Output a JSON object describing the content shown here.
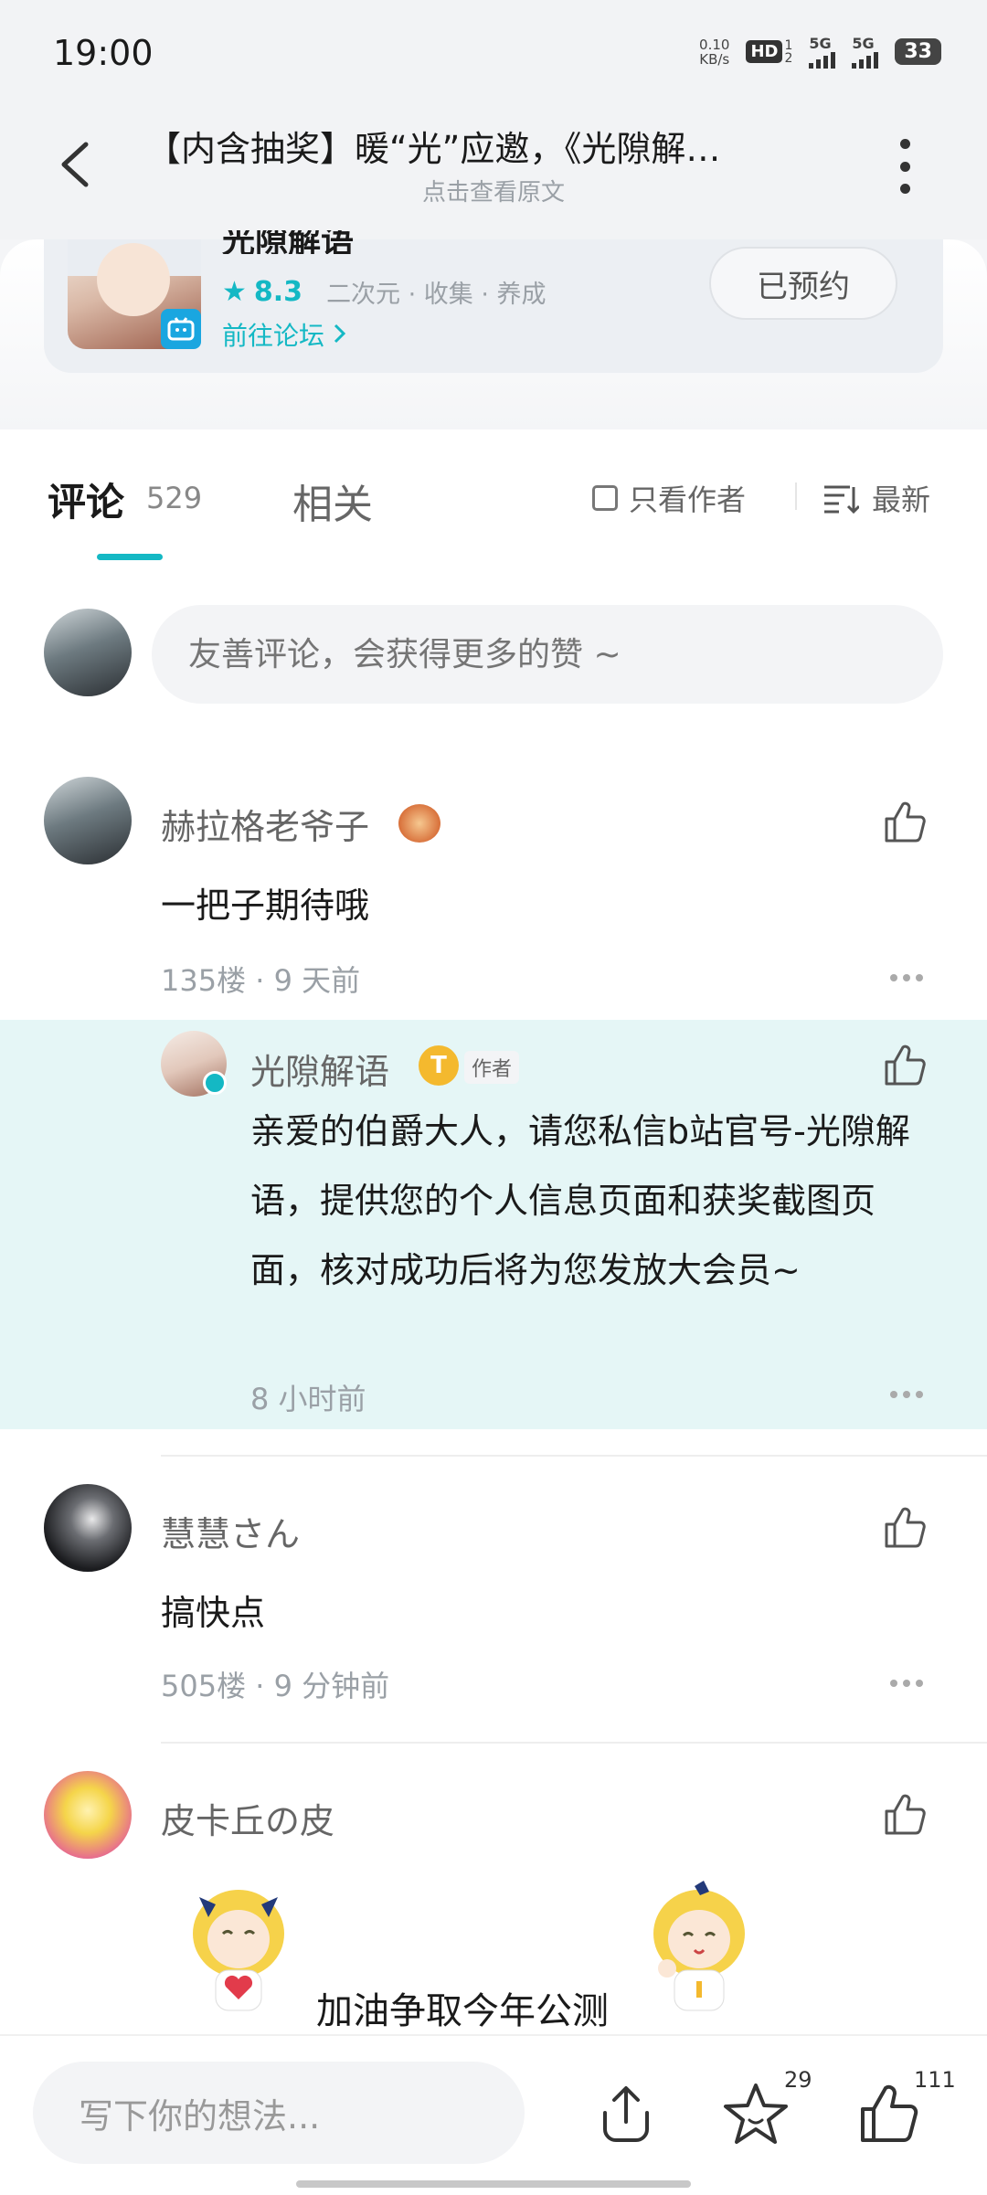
{
  "status_bar": {
    "time": "19:00",
    "net_speed_value": "0.10",
    "net_speed_unit": "KB/s",
    "hd": "HD",
    "sim1": "1",
    "sim2": "2",
    "signal_label_1": "5G",
    "signal_label_2": "5G",
    "battery": "33"
  },
  "header": {
    "title": "【内含抽奖】暖“光”应邀，《光隙解…",
    "subtitle": "点击查看原文"
  },
  "game_card": {
    "name": "光隙解语",
    "rating": "8.3",
    "tags": "二次元  ·  收集  ·  养成",
    "forum_link": "前往论坛 ",
    "reserve_label": "已预约"
  },
  "tabs": {
    "comments_label": "评论",
    "comments_count": "529",
    "related_label": "相关",
    "only_author_label": "只看作者",
    "sort_label": "最新"
  },
  "comment_input": {
    "placeholder": "友善评论，会获得更多的赞 ~"
  },
  "comments": [
    {
      "username": "赫拉格老爷子",
      "text": "一把子期待哦",
      "meta": "135楼  ·  9 天前"
    },
    {
      "username": "慧慧さん",
      "text": "搞快点",
      "meta": "505楼  ·  9 分钟前"
    },
    {
      "username": "皮卡丘の皮",
      "text": "加油争取今年公测"
    }
  ],
  "reply": {
    "username": "光隙解语",
    "author_tag": "作者",
    "text": "亲爱的伯爵大人，请您私信b站官号-光隙解语，提供您的个人信息页面和获奖截图页面，核对成功后将为您发放大会员~",
    "time": "8 小时前"
  },
  "bottom_bar": {
    "input_placeholder": "写下你的想法...",
    "favorite_count": "29",
    "like_count": "111"
  },
  "colors": {
    "accent": "#14b8c4",
    "reply_bg": "#e5f6f6"
  }
}
